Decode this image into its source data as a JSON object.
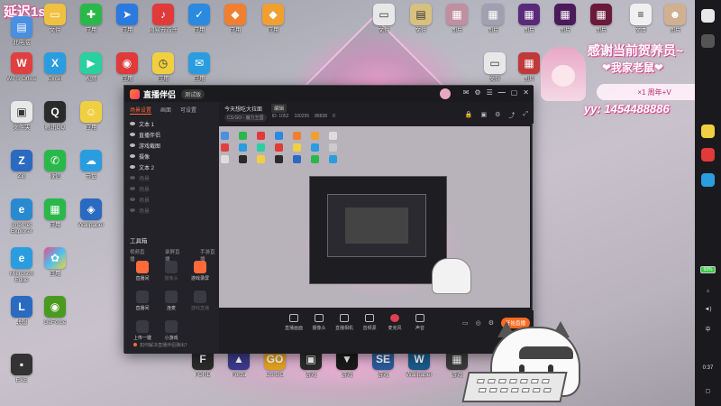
{
  "overlay": {
    "latency": "延迟1s 哦",
    "thanks": "感谢当前贺养员~",
    "fans": "❤我家老鼠❤",
    "offer": "×1 周年+V",
    "yy": "yy: 1454488886"
  },
  "desktop": {
    "icons": [
      {
        "label": "此电脑",
        "color": "#4a8fe0",
        "glyph": "▤"
      },
      {
        "label": "网易云音乐",
        "color": "#e03a3a",
        "glyph": "♪"
      },
      {
        "label": "腾讯QQ",
        "color": "#2a9de0",
        "glyph": "Q"
      },
      {
        "label": "WPS Office",
        "color": "#e04040",
        "glyph": "W"
      },
      {
        "label": "Excel",
        "color": "#2a9de0",
        "glyph": "X"
      },
      {
        "label": "Microsoft Edge",
        "color": "#2a8ae0",
        "glyph": "e"
      },
      {
        "label": "Zip",
        "color": "#2a6ac0",
        "glyph": "Z"
      },
      {
        "label": "微信",
        "color": "#2ab84a",
        "glyph": "✆"
      },
      {
        "label": "Internet Explorer",
        "color": "#2a8ad0",
        "glyph": "e"
      },
      {
        "label": "Microsoft Edge",
        "color": "#2a9de0",
        "glyph": "e"
      },
      {
        "label": "联想",
        "color": "#2a6ac0",
        "glyph": "L"
      },
      {
        "label": "EXE",
        "color": "#333333",
        "glyph": "▪"
      }
    ]
  },
  "app": {
    "title": "直播伴侣",
    "badge": "测试版",
    "side_tabs": [
      "场景设置",
      "画面",
      "可设置"
    ],
    "layers": [
      "文本 1",
      "直播伴侣",
      "游戏截图",
      "摄像",
      "文本 2",
      "场景",
      "场景",
      "场景",
      "场景"
    ],
    "tools_header": "工具箱",
    "tool_tabs": [
      "视频直播",
      "录屏直播",
      "手游直播"
    ],
    "tools": [
      "直播间",
      "摄像头",
      "游戏录屏",
      "直播间",
      "连麦",
      "游戏直播",
      "录屏",
      "全屏录制",
      "语音",
      "上传一键",
      "小游戏",
      ""
    ],
    "room_title": "今天想吃大拉面",
    "room_tag": "编辑",
    "room_meta": [
      "CS:GO - 魔力王国",
      "ID: 1052",
      "100255",
      "88838",
      "0"
    ],
    "bottom_items": [
      "直播画面",
      "摄像头",
      "直播相机",
      "音频源",
      "麦克风",
      "声音"
    ],
    "live_button": "开始直播",
    "foot_note": "如何解决直播伴侣弹出？"
  },
  "taskbar": {
    "battery": "99%",
    "time": "0:37"
  }
}
